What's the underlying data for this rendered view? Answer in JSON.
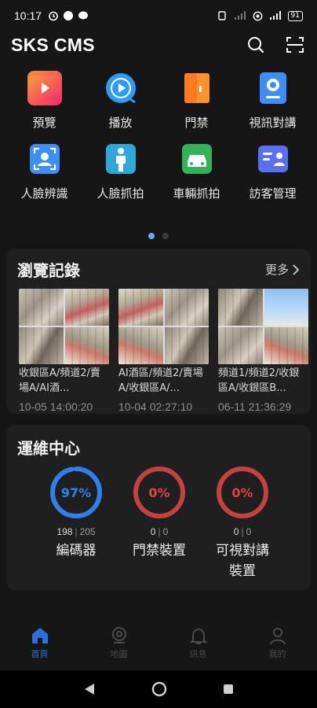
{
  "status_bar": {
    "time": "10:17",
    "battery": "91"
  },
  "header": {
    "title": "SKS CMS"
  },
  "menu": {
    "items": [
      {
        "label": "預覽",
        "icon": "preview-icon",
        "color": "#ff5a5a"
      },
      {
        "label": "播放",
        "icon": "playback-icon",
        "color": "#2f9bf5"
      },
      {
        "label": "門禁",
        "icon": "door-access-icon",
        "color": "#f28a2e"
      },
      {
        "label": "視訊對講",
        "icon": "video-intercom-icon",
        "color": "#3d8ff5"
      },
      {
        "label": "人臉辨識",
        "icon": "face-recognition-icon",
        "color": "#3d8ff5"
      },
      {
        "label": "人臉抓拍",
        "icon": "face-capture-icon",
        "color": "#2fa7d8"
      },
      {
        "label": "車輛抓拍",
        "icon": "vehicle-capture-icon",
        "color": "#34b15a"
      },
      {
        "label": "訪客管理",
        "icon": "visitor-management-icon",
        "color": "#5a6ff0"
      }
    ],
    "page_count": 2,
    "active_page": 0
  },
  "history": {
    "title": "瀏覽記錄",
    "more": "更多",
    "items": [
      {
        "name": "收銀區A/頻道2/賣場A/AI酒...",
        "time": "10-05 14:00:20"
      },
      {
        "name": "AI酒區/頻道2/賣場A/收銀區A/...",
        "time": "10-04 02:27:10"
      },
      {
        "name": "頻道1/頻道2/收銀區A/收銀區B...",
        "time": "06-11 21:36:29"
      }
    ]
  },
  "ops": {
    "title": "運維中心",
    "gauges": [
      {
        "percent_text": "97%",
        "value": 0.97,
        "online": "198",
        "total": "205",
        "label": "編碼器",
        "color": "#2f80ed"
      },
      {
        "percent_text": "0%",
        "value": 0,
        "online": "0",
        "total": "0",
        "label": "門禁裝置",
        "color": "#e04444"
      },
      {
        "percent_text": "0%",
        "value": 0,
        "online": "0",
        "total": "0",
        "label": "可視對講裝置",
        "color": "#e04444"
      }
    ],
    "separator": "|"
  },
  "bottom_nav": {
    "items": [
      {
        "label": "首頁",
        "active": true
      },
      {
        "label": "地圖",
        "active": false
      },
      {
        "label": "訊息",
        "active": false
      },
      {
        "label": "我的",
        "active": false
      }
    ]
  }
}
